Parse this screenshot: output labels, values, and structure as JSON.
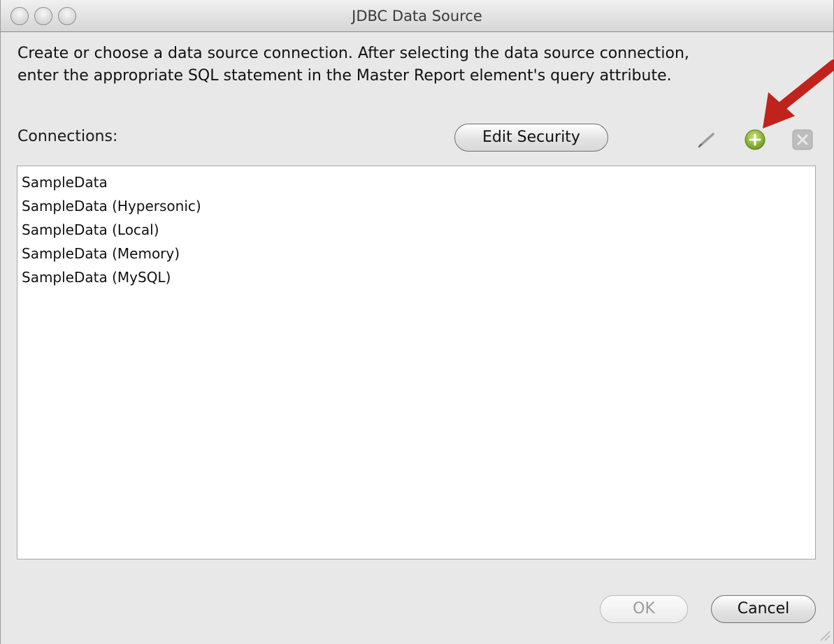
{
  "window": {
    "title": "JDBC Data Source"
  },
  "description": {
    "line1": "Create or choose a data source connection. After selecting the data source connection,",
    "line2": "enter the appropriate SQL statement in the Master Report element's query attribute."
  },
  "connections": {
    "label": "Connections:",
    "edit_security_label": "Edit Security",
    "items": [
      "SampleData",
      "SampleData (Hypersonic)",
      "SampleData (Local)",
      "SampleData (Memory)",
      "SampleData (MySQL)"
    ]
  },
  "footer": {
    "ok_label": "OK",
    "cancel_label": "Cancel"
  },
  "icons": {
    "edit": "pencil-icon",
    "add": "add-plus-icon",
    "remove": "remove-x-icon",
    "annotation": "red-arrow-icon"
  },
  "colors": {
    "add_icon": "#8db531",
    "annotation_arrow": "#c0231c"
  }
}
